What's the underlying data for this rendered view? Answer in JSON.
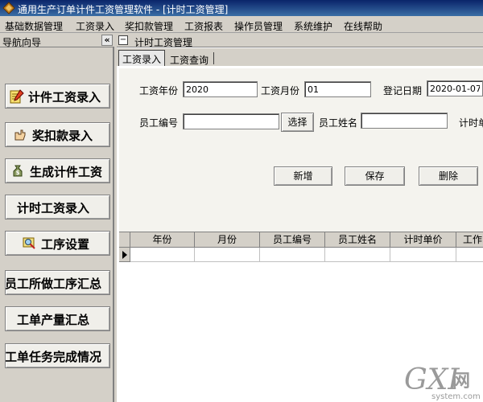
{
  "window": {
    "title": "通用生产订单计件工资管理软件 - [计时工资管理]"
  },
  "menu": [
    "基础数据管理",
    "工资录入",
    "奖扣款管理",
    "工资报表",
    "操作员管理",
    "系统维护",
    "在线帮助"
  ],
  "nav": {
    "title": "导航向导",
    "collapse": "«",
    "items": [
      {
        "label": "计件工资录入",
        "icon": "pencil-notepad-icon"
      },
      {
        "label": "奖扣款录入",
        "icon": "hand-pointer-icon"
      },
      {
        "label": "生成计件工资",
        "icon": "money-bag-icon"
      },
      {
        "label": "计时工资录入",
        "icon": ""
      },
      {
        "label": "工序设置",
        "icon": "search-card-icon"
      },
      {
        "label": "员工所做工序汇总",
        "icon": ""
      },
      {
        "label": "工单产量汇总",
        "icon": ""
      },
      {
        "label": "工单任务完成情况",
        "icon": ""
      }
    ]
  },
  "main": {
    "title": "计时工资管理",
    "collapse": "−",
    "tabs": [
      "工资录入",
      "工资查询"
    ],
    "form": {
      "year_label": "工资年份",
      "year_value": "2020",
      "month_label": "工资月份",
      "month_value": "01",
      "date_label": "登记日期",
      "date_value": "2020-01-07",
      "emp_no_label": "员工编号",
      "emp_no_value": "",
      "choose_button": "选择",
      "emp_name_label": "员工姓名",
      "emp_name_value": "",
      "hourly_label": "计时单"
    },
    "actions": {
      "add": "新增",
      "save": "保存",
      "delete": "删除"
    },
    "grid": {
      "columns": [
        "年份",
        "月份",
        "员工编号",
        "员工姓名",
        "计时单价",
        "工作"
      ]
    }
  },
  "watermark": {
    "brand": "GXI",
    "zh": "网",
    "site": "system.com"
  },
  "colors": {
    "titlebar": "#0a246a",
    "panel": "#d4d0c8"
  }
}
